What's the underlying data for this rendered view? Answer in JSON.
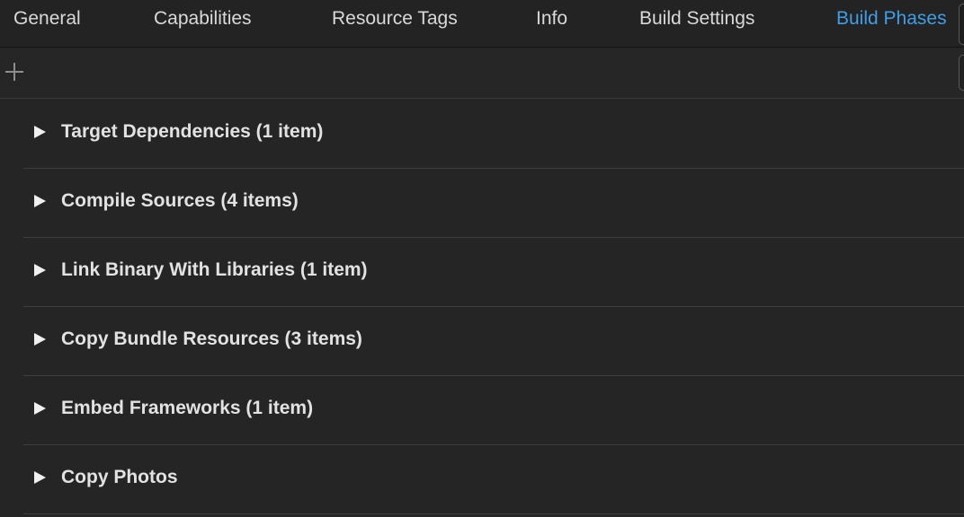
{
  "tabs": [
    {
      "label": "General",
      "active": false
    },
    {
      "label": "Capabilities",
      "active": false
    },
    {
      "label": "Resource Tags",
      "active": false
    },
    {
      "label": "Info",
      "active": false
    },
    {
      "label": "Build Settings",
      "active": false
    },
    {
      "label": "Build Phases",
      "active": true
    }
  ],
  "toolbar": {
    "add_icon": "plus-icon"
  },
  "phases": [
    {
      "label": "Target Dependencies (1 item)",
      "icon": "disclosure-triangle-right-icon"
    },
    {
      "label": "Compile Sources (4 items)",
      "icon": "disclosure-triangle-right-icon"
    },
    {
      "label": "Link Binary With Libraries (1 item)",
      "icon": "disclosure-triangle-right-icon"
    },
    {
      "label": "Copy Bundle Resources (3 items)",
      "icon": "disclosure-triangle-right-icon"
    },
    {
      "label": "Embed Frameworks (1 item)",
      "icon": "disclosure-triangle-right-icon"
    },
    {
      "label": "Copy Photos",
      "icon": "disclosure-triangle-right-icon"
    }
  ],
  "colors": {
    "background": "#252526",
    "active_tab": "#3e9fe6",
    "text": "#e2e2e2"
  }
}
